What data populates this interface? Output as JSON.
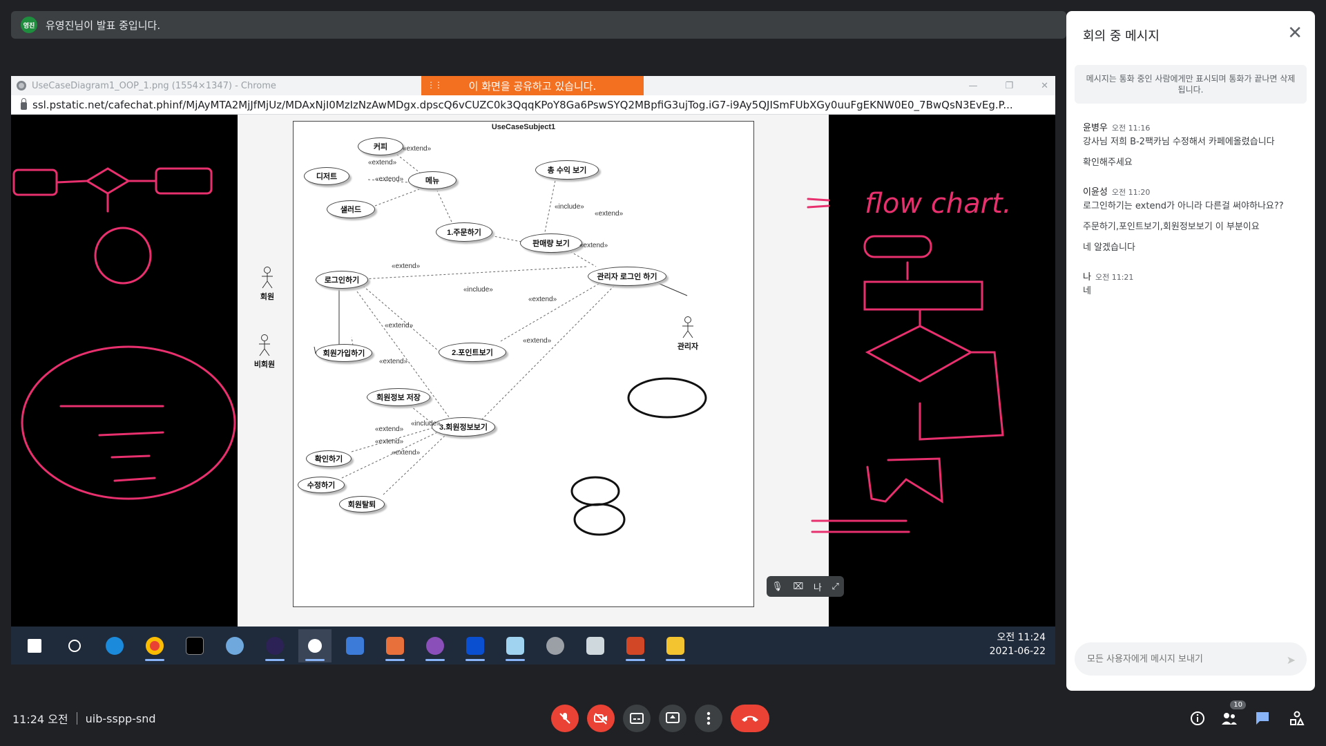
{
  "presenter": {
    "avatar_text": "영진",
    "banner": "유영진님이 발표 중입니다."
  },
  "browser": {
    "title": "UseCaseDiagram1_OOP_1.png (1554×1347) - Chrome",
    "share_banner": "이 화면을 공유하고 있습니다.",
    "url": "ssl.pstatic.net/cafechat.phinf/MjAyMTA2MjJfMjUz/MDAxNjI0MzIzNzAwMDgx.dpscQ6vCUZC0k3QqqKPoY8Ga6PswSYQ2MBpfiG3ujTog.iG7-i9Ay5QJISmFUbXGy0uuFgEKNW0E0_7BwQsN3EvEg.P..."
  },
  "diagram": {
    "title": "UseCaseSubject1",
    "usecases": {
      "coffee": "커피",
      "dessert": "디저트",
      "salad": "샐러드",
      "menu": "메뉴",
      "total_revenue": "총 수익 보기",
      "order": "1.주문하기",
      "sales": "판매량 보기",
      "login": "로그인하기",
      "admin_login": "관리자 로그인 하기",
      "points": "2.포인트보기",
      "signup": "회원가입하기",
      "save_member": "회원정보 저장",
      "member_info": "3.회원정보보기",
      "confirm": "확인하기",
      "edit": "수정하기",
      "withdraw": "회원탈퇴"
    },
    "actors": {
      "member": "회원",
      "non_member": "비회원",
      "admin": "관리자"
    },
    "relations": {
      "extend": "«extend»",
      "include": "«include»"
    }
  },
  "taskbar": {
    "time": "오전 11:24",
    "date": "2021-06-22"
  },
  "self_view": {
    "label": "나"
  },
  "chat": {
    "title": "회의 중 메시지",
    "notice": "메시지는 통화 중인 사람에게만 표시되며 통화가 끝나면 삭제됩니다.",
    "messages": [
      {
        "sender": "윤병우",
        "time": "오전 11:16",
        "texts": [
          "강사님 저희 B-2팩카님 수정해서 카페에올렸습니다",
          "확인해주세요"
        ]
      },
      {
        "sender": "이윤성",
        "time": "오전 11:20",
        "texts": [
          "로그인하기는 extend가 아니라 다른걸 써야하나요??",
          "주문하기,포인트보기,회원정보보기 이 부분이요",
          "네 알겠습니다"
        ]
      },
      {
        "sender": "나",
        "time": "오전 11:21",
        "texts": [
          "네"
        ]
      }
    ],
    "input_placeholder": "모든 사용자에게 메시지 보내기"
  },
  "meeting": {
    "time": "11:24 오전",
    "code": "uib-sspp-snd",
    "participants_count": "10"
  }
}
